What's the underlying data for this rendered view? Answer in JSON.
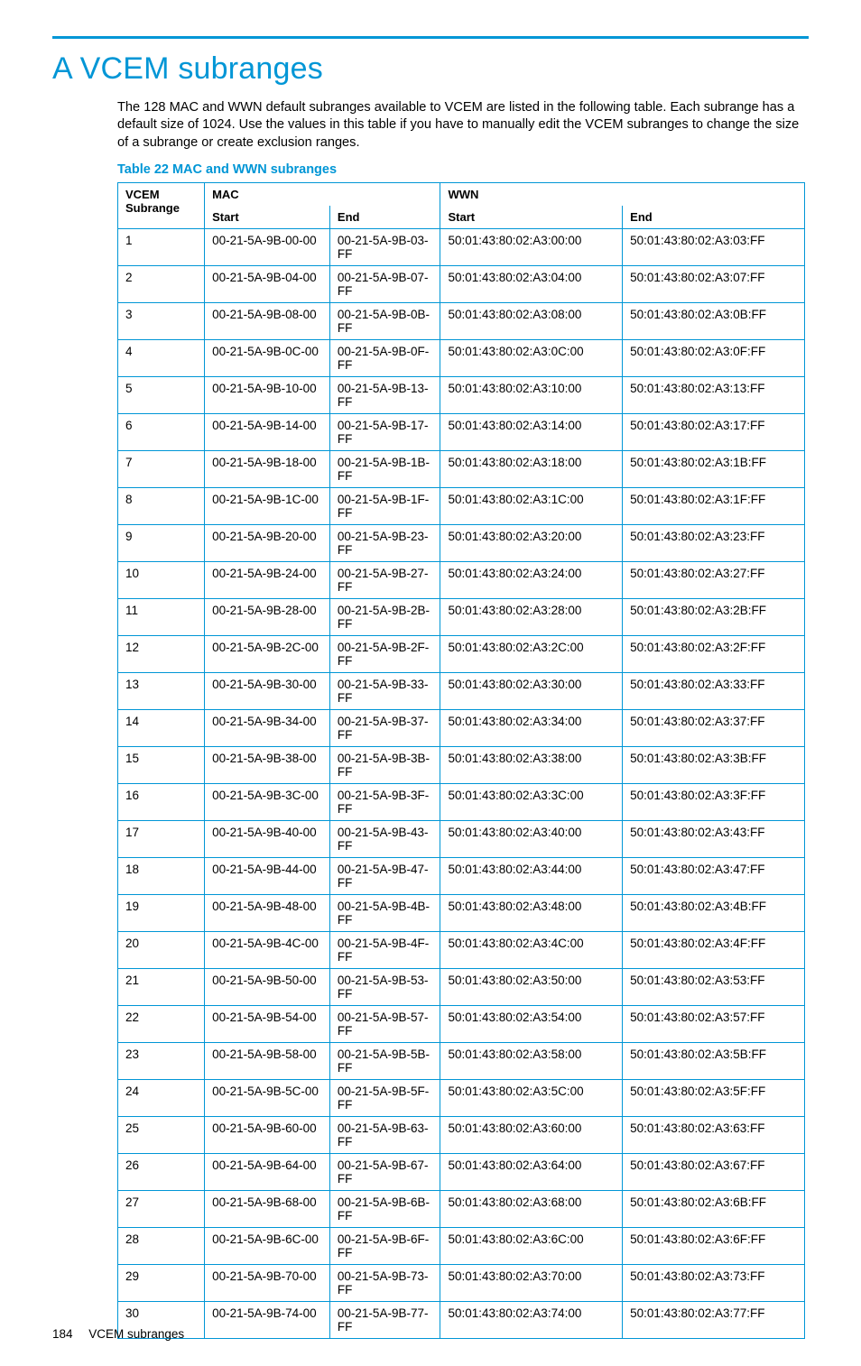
{
  "heading": "A VCEM subranges",
  "intro": "The 128 MAC and WWN default subranges available to VCEM are listed in the following table. Each subrange has a default size of 1024. Use the values in this table if you have to manually edit the VCEM subranges to change the size of a subrange or create exclusion ranges.",
  "table_title": "Table 22 MAC and WWN subranges",
  "columns": {
    "subrange": "VCEM Subrange",
    "mac": "MAC",
    "wwn": "WWN",
    "start": "Start",
    "end": "End"
  },
  "rows": [
    {
      "n": "1",
      "ms": "00-21-5A-9B-00-00",
      "me": "00-21-5A-9B-03-FF",
      "ws": "50:01:43:80:02:A3:00:00",
      "we": "50:01:43:80:02:A3:03:FF"
    },
    {
      "n": "2",
      "ms": "00-21-5A-9B-04-00",
      "me": "00-21-5A-9B-07-FF",
      "ws": "50:01:43:80:02:A3:04:00",
      "we": "50:01:43:80:02:A3:07:FF"
    },
    {
      "n": "3",
      "ms": "00-21-5A-9B-08-00",
      "me": "00-21-5A-9B-0B-FF",
      "ws": "50:01:43:80:02:A3:08:00",
      "we": "50:01:43:80:02:A3:0B:FF"
    },
    {
      "n": "4",
      "ms": "00-21-5A-9B-0C-00",
      "me": "00-21-5A-9B-0F-FF",
      "ws": "50:01:43:80:02:A3:0C:00",
      "we": "50:01:43:80:02:A3:0F:FF"
    },
    {
      "n": "5",
      "ms": "00-21-5A-9B-10-00",
      "me": "00-21-5A-9B-13-FF",
      "ws": "50:01:43:80:02:A3:10:00",
      "we": "50:01:43:80:02:A3:13:FF"
    },
    {
      "n": "6",
      "ms": "00-21-5A-9B-14-00",
      "me": "00-21-5A-9B-17-FF",
      "ws": "50:01:43:80:02:A3:14:00",
      "we": "50:01:43:80:02:A3:17:FF"
    },
    {
      "n": "7",
      "ms": "00-21-5A-9B-18-00",
      "me": "00-21-5A-9B-1B-FF",
      "ws": "50:01:43:80:02:A3:18:00",
      "we": "50:01:43:80:02:A3:1B:FF"
    },
    {
      "n": "8",
      "ms": "00-21-5A-9B-1C-00",
      "me": "00-21-5A-9B-1F-FF",
      "ws": "50:01:43:80:02:A3:1C:00",
      "we": "50:01:43:80:02:A3:1F:FF"
    },
    {
      "n": "9",
      "ms": "00-21-5A-9B-20-00",
      "me": "00-21-5A-9B-23-FF",
      "ws": "50:01:43:80:02:A3:20:00",
      "we": "50:01:43:80:02:A3:23:FF"
    },
    {
      "n": "10",
      "ms": "00-21-5A-9B-24-00",
      "me": "00-21-5A-9B-27-FF",
      "ws": "50:01:43:80:02:A3:24:00",
      "we": "50:01:43:80:02:A3:27:FF"
    },
    {
      "n": "11",
      "ms": "00-21-5A-9B-28-00",
      "me": "00-21-5A-9B-2B-FF",
      "ws": "50:01:43:80:02:A3:28:00",
      "we": "50:01:43:80:02:A3:2B:FF"
    },
    {
      "n": "12",
      "ms": "00-21-5A-9B-2C-00",
      "me": "00-21-5A-9B-2F-FF",
      "ws": "50:01:43:80:02:A3:2C:00",
      "we": "50:01:43:80:02:A3:2F:FF"
    },
    {
      "n": "13",
      "ms": "00-21-5A-9B-30-00",
      "me": "00-21-5A-9B-33-FF",
      "ws": "50:01:43:80:02:A3:30:00",
      "we": "50:01:43:80:02:A3:33:FF"
    },
    {
      "n": "14",
      "ms": "00-21-5A-9B-34-00",
      "me": "00-21-5A-9B-37-FF",
      "ws": "50:01:43:80:02:A3:34:00",
      "we": "50:01:43:80:02:A3:37:FF"
    },
    {
      "n": "15",
      "ms": "00-21-5A-9B-38-00",
      "me": "00-21-5A-9B-3B-FF",
      "ws": "50:01:43:80:02:A3:38:00",
      "we": "50:01:43:80:02:A3:3B:FF"
    },
    {
      "n": "16",
      "ms": "00-21-5A-9B-3C-00",
      "me": "00-21-5A-9B-3F-FF",
      "ws": "50:01:43:80:02:A3:3C:00",
      "we": "50:01:43:80:02:A3:3F:FF"
    },
    {
      "n": "17",
      "ms": "00-21-5A-9B-40-00",
      "me": "00-21-5A-9B-43-FF",
      "ws": "50:01:43:80:02:A3:40:00",
      "we": "50:01:43:80:02:A3:43:FF"
    },
    {
      "n": "18",
      "ms": "00-21-5A-9B-44-00",
      "me": "00-21-5A-9B-47-FF",
      "ws": "50:01:43:80:02:A3:44:00",
      "we": "50:01:43:80:02:A3:47:FF"
    },
    {
      "n": "19",
      "ms": "00-21-5A-9B-48-00",
      "me": "00-21-5A-9B-4B-FF",
      "ws": "50:01:43:80:02:A3:48:00",
      "we": "50:01:43:80:02:A3:4B:FF"
    },
    {
      "n": "20",
      "ms": "00-21-5A-9B-4C-00",
      "me": "00-21-5A-9B-4F-FF",
      "ws": "50:01:43:80:02:A3:4C:00",
      "we": "50:01:43:80:02:A3:4F:FF"
    },
    {
      "n": "21",
      "ms": "00-21-5A-9B-50-00",
      "me": "00-21-5A-9B-53-FF",
      "ws": "50:01:43:80:02:A3:50:00",
      "we": "50:01:43:80:02:A3:53:FF"
    },
    {
      "n": "22",
      "ms": "00-21-5A-9B-54-00",
      "me": "00-21-5A-9B-57-FF",
      "ws": "50:01:43:80:02:A3:54:00",
      "we": "50:01:43:80:02:A3:57:FF"
    },
    {
      "n": "23",
      "ms": "00-21-5A-9B-58-00",
      "me": "00-21-5A-9B-5B-FF",
      "ws": "50:01:43:80:02:A3:58:00",
      "we": "50:01:43:80:02:A3:5B:FF"
    },
    {
      "n": "24",
      "ms": "00-21-5A-9B-5C-00",
      "me": "00-21-5A-9B-5F-FF",
      "ws": "50:01:43:80:02:A3:5C:00",
      "we": "50:01:43:80:02:A3:5F:FF"
    },
    {
      "n": "25",
      "ms": "00-21-5A-9B-60-00",
      "me": "00-21-5A-9B-63-FF",
      "ws": "50:01:43:80:02:A3:60:00",
      "we": "50:01:43:80:02:A3:63:FF"
    },
    {
      "n": "26",
      "ms": "00-21-5A-9B-64-00",
      "me": "00-21-5A-9B-67-FF",
      "ws": "50:01:43:80:02:A3:64:00",
      "we": "50:01:43:80:02:A3:67:FF"
    },
    {
      "n": "27",
      "ms": "00-21-5A-9B-68-00",
      "me": "00-21-5A-9B-6B-FF",
      "ws": "50:01:43:80:02:A3:68:00",
      "we": "50:01:43:80:02:A3:6B:FF"
    },
    {
      "n": "28",
      "ms": "00-21-5A-9B-6C-00",
      "me": "00-21-5A-9B-6F-FF",
      "ws": "50:01:43:80:02:A3:6C:00",
      "we": "50:01:43:80:02:A3:6F:FF"
    },
    {
      "n": "29",
      "ms": "00-21-5A-9B-70-00",
      "me": "00-21-5A-9B-73-FF",
      "ws": "50:01:43:80:02:A3:70:00",
      "we": "50:01:43:80:02:A3:73:FF"
    },
    {
      "n": "30",
      "ms": "00-21-5A-9B-74-00",
      "me": "00-21-5A-9B-77-FF",
      "ws": "50:01:43:80:02:A3:74:00",
      "we": "50:01:43:80:02:A3:77:FF"
    }
  ],
  "footer": {
    "page_number": "184",
    "section": "VCEM subranges"
  }
}
